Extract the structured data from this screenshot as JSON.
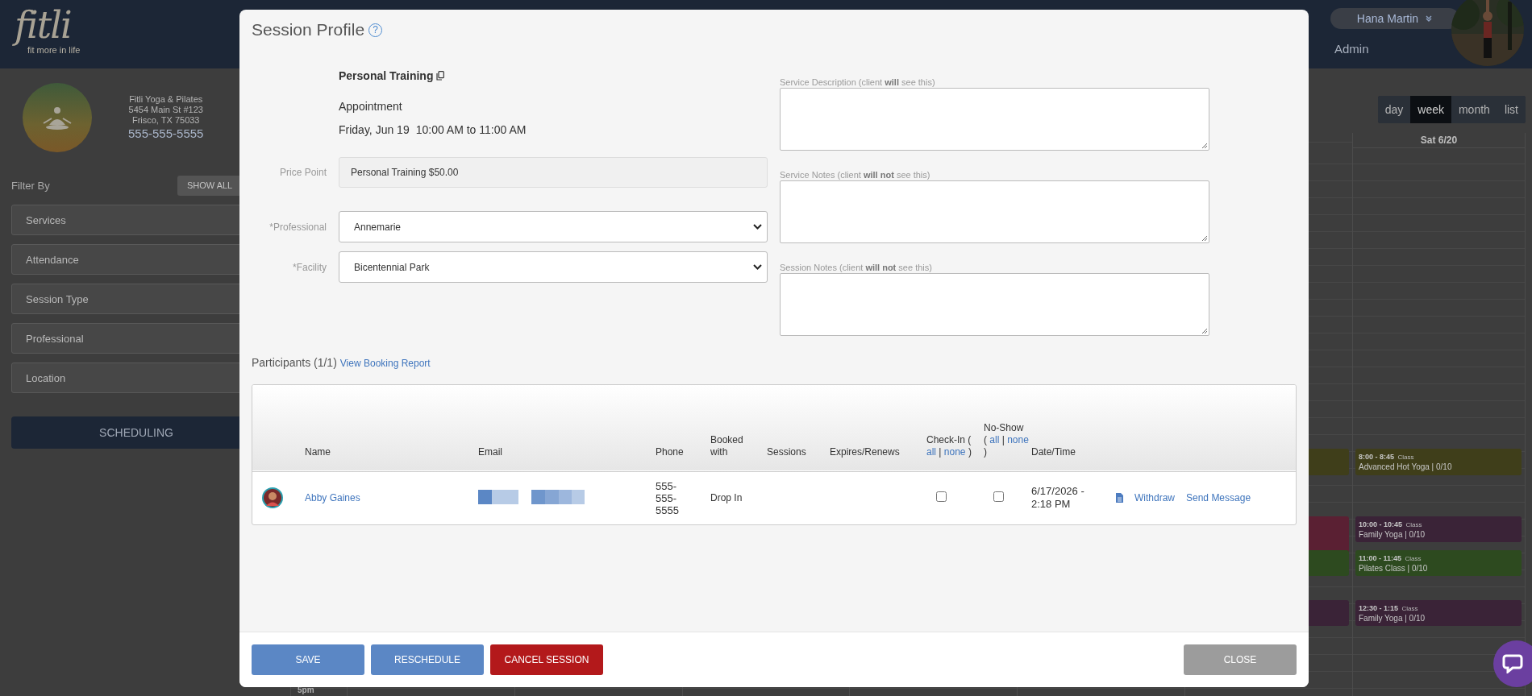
{
  "header": {
    "logo": {
      "wordmark": "fitli",
      "tagline": "fit more in life"
    },
    "user_name": "Hana Martin",
    "nav": [
      {
        "label": "Admin"
      }
    ]
  },
  "sidebar": {
    "studio": {
      "name": "Fitli Yoga & Pilates",
      "address": [
        "5454 Main St #123",
        "Frisco, TX 75033"
      ],
      "phone": "555-555-5555"
    },
    "filter_label": "Filter By",
    "show_all": "SHOW ALL",
    "filters": [
      "Services",
      "Attendance",
      "Session Type",
      "Professional",
      "Location"
    ],
    "primary_button": "SCHEDULING"
  },
  "calendar": {
    "views": [
      {
        "label": "day",
        "selected": false
      },
      {
        "label": "week",
        "selected": true
      },
      {
        "label": "month",
        "selected": false
      },
      {
        "label": "list",
        "selected": false
      }
    ],
    "day_header": "Sat 6/20",
    "time_label": "5pm",
    "events": [
      {
        "time": "8:00 - 8:45",
        "type": "Class",
        "title": "Advanced Hot Yoga | 0/10",
        "color": "#3f3e1a"
      },
      {
        "time": "10:00 - 10:45",
        "type": "Class",
        "title": "Family Yoga | 0/10",
        "color": "#3a2337"
      },
      {
        "time": "11:00 - 11:45",
        "type": "Class",
        "title": "Pilates Class | 0/10",
        "color": "#2d4a1f"
      },
      {
        "time": "12:30 - 1:15",
        "type": "Class",
        "title": "Family Yoga | 0/10",
        "color": "#3a2337"
      }
    ],
    "partial_events": [
      {
        "color": "#3f3e1a"
      },
      {
        "color": "#5a2033"
      },
      {
        "color": "#2d4a1f"
      },
      {
        "color": "#3a2337"
      }
    ]
  },
  "modal": {
    "title": "Session Profile",
    "help": "?",
    "service": {
      "name": "Personal Training",
      "type": "Appointment",
      "date": "Friday, Jun 19",
      "time": "10:00 AM to 11:00 AM"
    },
    "fields": [
      {
        "label": "Price Point",
        "kind": "readonly",
        "value": "Personal Training $50.00"
      },
      {
        "label": "*Professional",
        "kind": "select",
        "value": "Annemarie"
      },
      {
        "label": "*Facility",
        "kind": "select",
        "value": "Bicentennial Park"
      }
    ],
    "notes": [
      {
        "label": "Service Description (client **will** see this)"
      },
      {
        "label": "Service Notes (client **will not** see this)"
      },
      {
        "label": "Session Notes (client **will not** see this)"
      }
    ],
    "participants": {
      "heading": "Participants (1/1)",
      "report_link": "View Booking Report",
      "columns": [
        {
          "parts": [
            {
              "kind": "text",
              "text": "Name"
            }
          ]
        },
        {
          "parts": [
            {
              "kind": "text",
              "text": "Email"
            }
          ]
        },
        {
          "parts": [
            {
              "kind": "text",
              "text": "Phone"
            }
          ]
        },
        {
          "parts": [
            {
              "kind": "text",
              "text": "Booked with"
            }
          ]
        },
        {
          "parts": [
            {
              "kind": "text",
              "text": "Sessions"
            }
          ]
        },
        {
          "parts": [
            {
              "kind": "text",
              "text": "Expires/Renews"
            }
          ]
        },
        {
          "parts": [
            {
              "kind": "text",
              "text": "Check-In ("
            },
            {
              "kind": "link",
              "text": "all"
            },
            {
              "kind": "text",
              "text": "|"
            },
            {
              "kind": "link",
              "text": "none"
            },
            {
              "kind": "text",
              "text": ")"
            }
          ]
        },
        {
          "parts": [
            {
              "kind": "text",
              "text": "No-Show ("
            },
            {
              "kind": "link",
              "text": "all"
            },
            {
              "kind": "text",
              "text": "|"
            },
            {
              "kind": "link",
              "text": "none"
            },
            {
              "kind": "text",
              "text": ")"
            }
          ]
        },
        {
          "parts": [
            {
              "kind": "text",
              "text": "Date/Time"
            }
          ]
        }
      ],
      "rows": [
        {
          "name": "Abby Gaines",
          "phone": "555-555-5555",
          "booked_with": "Drop In",
          "checked_in": false,
          "no_show": false,
          "date_time": "6/17/2026 - 2:18 PM",
          "actions": [
            "Withdraw",
            "Send Message"
          ]
        }
      ]
    }
  },
  "buttons": [
    {
      "label": "SAVE",
      "kind": "primary"
    },
    {
      "label": "RESCHEDULE",
      "kind": "primary"
    },
    {
      "label": "CANCEL SESSION",
      "kind": "danger"
    },
    {
      "label": "CLOSE",
      "kind": "secondary"
    }
  ]
}
